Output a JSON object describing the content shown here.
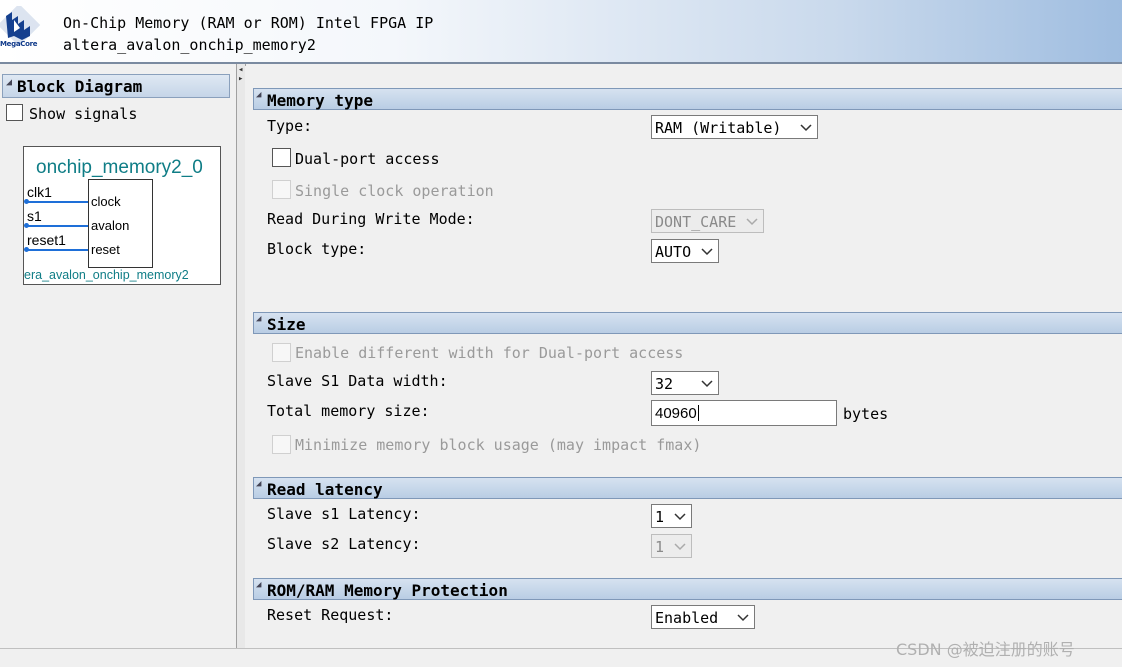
{
  "header": {
    "logo_text": "MegaCore",
    "title": "On-Chip Memory (RAM or ROM) Intel FPGA IP",
    "subtitle": "altera_avalon_onchip_memory2"
  },
  "left_panel": {
    "section_title": "Block Diagram",
    "show_signals_label": "Show signals",
    "component": {
      "name": "onchip_memory2_0",
      "class_label": "era_avalon_onchip_memory2",
      "external_ports": [
        "clk1",
        "s1",
        "reset1"
      ],
      "internal_ports": [
        "clock",
        "avalon",
        "reset"
      ]
    }
  },
  "memory_type": {
    "title": "Memory type",
    "type_label": "Type:",
    "type_value": "RAM (Writable)",
    "dual_port_label": "Dual-port access",
    "single_clock_label": "Single clock operation",
    "rdw_label": "Read During Write Mode:",
    "rdw_value": "DONT_CARE",
    "block_type_label": "Block type:",
    "block_type_value": "AUTO"
  },
  "size": {
    "title": "Size",
    "diff_width_label": "Enable different width for Dual-port access",
    "data_width_label": "Slave S1 Data width:",
    "data_width_value": "32",
    "total_size_label": "Total memory size:",
    "total_size_value": "40960",
    "total_size_unit": "bytes",
    "minimize_label": "Minimize memory block usage (may impact fmax)"
  },
  "read_latency": {
    "title": "Read latency",
    "s1_label": "Slave s1 Latency:",
    "s1_value": "1",
    "s2_label": "Slave s2 Latency:",
    "s2_value": "1"
  },
  "protection": {
    "title": "ROM/RAM Memory Protection",
    "reset_request_label": "Reset Request:",
    "reset_request_value": "Enabled"
  },
  "watermark": "CSDN @被迫注册的账号"
}
